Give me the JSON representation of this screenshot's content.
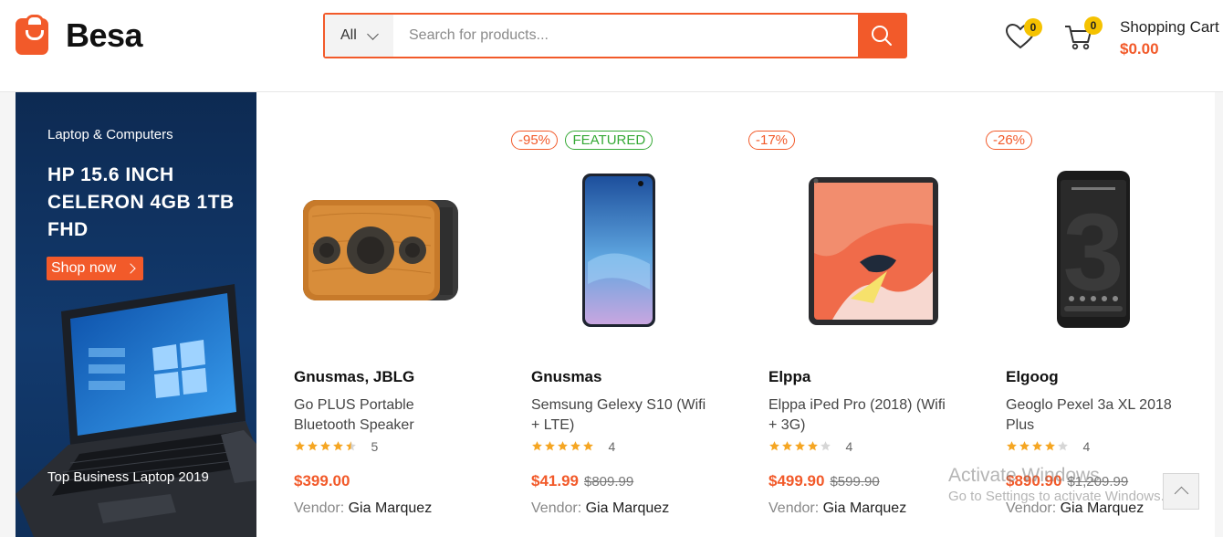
{
  "header": {
    "logo_text": "Besa",
    "search": {
      "category": "All",
      "placeholder": "Search for products...",
      "icon": "search-icon"
    },
    "wishlist": {
      "icon": "heart-icon",
      "count": "0"
    },
    "cart": {
      "icon": "cart-icon",
      "count": "0",
      "label": "Shopping Cart",
      "total": "$0.00"
    }
  },
  "banner": {
    "eyebrow": "Laptop & Computers",
    "title": "HP 15.6 INCH CELERON 4GB 1TB FHD",
    "button": "Shop now",
    "footer": "Top Business Laptop 2019"
  },
  "products": [
    {
      "badges": [],
      "brand": "Gnusmas, JBLG",
      "name": "Go PLUS Portable Bluetooth Speaker",
      "rating": 4.5,
      "review_count": "5",
      "price": "$399.00",
      "old_price": "",
      "vendor_label": "Vendor:",
      "vendor": "Gia Marquez"
    },
    {
      "badges": [
        "-95%",
        "FEATURED"
      ],
      "brand": "Gnusmas",
      "name": "Semsung Gelexy S10 (Wifi + LTE)",
      "rating": 5,
      "review_count": "4",
      "price": "$41.99",
      "old_price": "$809.99",
      "vendor_label": "Vendor:",
      "vendor": "Gia Marquez"
    },
    {
      "badges": [
        "-17%"
      ],
      "brand": "Elppa",
      "name": "Elppa iPed Pro (2018) (Wifi + 3G)",
      "rating": 4,
      "review_count": "4",
      "price": "$499.90",
      "old_price": "$599.90",
      "vendor_label": "Vendor:",
      "vendor": "Gia Marquez"
    },
    {
      "badges": [
        "-26%"
      ],
      "brand": "Elgoog",
      "name": "Geoglo Pexel 3a XL 2018 Plus",
      "rating": 4,
      "review_count": "4",
      "price": "$890.90",
      "old_price": "$1,209.99",
      "vendor_label": "Vendor:",
      "vendor": "Gia Marquez"
    }
  ],
  "watermark": {
    "line1": "Activate Windows",
    "line2": "Go to Settings to activate Windows."
  },
  "colors": {
    "accent": "#f25a2a",
    "badge": "#f5c200",
    "featured": "#35a935",
    "star": "#f5a623"
  }
}
